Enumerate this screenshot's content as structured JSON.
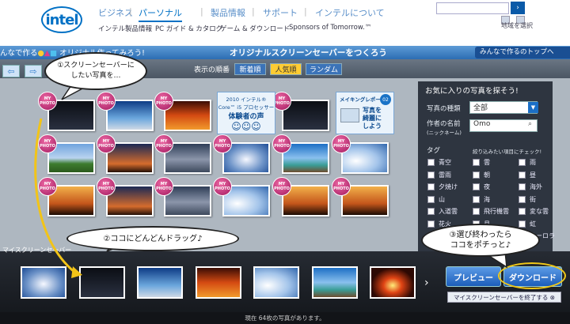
{
  "header": {
    "logo": "intel",
    "nav": [
      "ビジネス",
      "パーソナル",
      "製品情報",
      "サポート",
      "インテルについて"
    ],
    "active_index": 1,
    "subnav": [
      "インテル製品情報",
      "PC ガイド & カタログ",
      "ゲーム & ダウンロード",
      "Sponsors of Tomorrow.™"
    ],
    "search_button": "›",
    "region_label": "地域を選択"
  },
  "bluebar": {
    "left": "んなで作る",
    "left_cut": "オリジナル作ってみろう!",
    "title": "オリジナルスクリーンセーバーをつくろう",
    "right": "みんなで作るのトップへ"
  },
  "toolbar": {
    "sort_label": "表示の順番",
    "sort": [
      "新着順",
      "人気順",
      "ランダム"
    ],
    "active_sort": 1,
    "arrows": [
      "⇦",
      "⇨"
    ]
  },
  "grid": {
    "badge": "MY PHOTO",
    "rows": [
      [
        "s-night",
        "s-sky",
        "s-sunset",
        "promo1",
        "s-night",
        "promo2"
      ],
      [
        "s-green",
        "s-dusk",
        "s-lake",
        "s-cloud",
        "s-sea",
        "s-bright"
      ],
      [
        "s-palm",
        "s-dusk",
        "s-lake",
        "s-bright",
        "s-palm",
        "s-palm"
      ]
    ],
    "promo1": {
      "line1": "2010 インテル®",
      "line2": "Core™ i5 プロセッサー",
      "big": "体験者の声"
    },
    "promo2": {
      "title": "メイキングレポート",
      "num": "02",
      "text1": "写真を",
      "text2": "綺麗に",
      "text3": "しよう"
    }
  },
  "panel": {
    "title": "お気に入りの写真を探そう!",
    "type_label": "写真の種類",
    "type_value": "全部",
    "author_label": "作者の名前",
    "author_sub": "(ニックネーム)",
    "author_value": "Omo",
    "tag_label": "タグ",
    "tag_hint": "絞り込みたい項目にチェック!",
    "tags": [
      "青空",
      "雲",
      "雨",
      "雷雨",
      "朝",
      "昼",
      "夕焼け",
      "夜",
      "海外",
      "山",
      "海",
      "街",
      "入道雲",
      "飛行機雲",
      "変な雲",
      "花火",
      "月",
      "虹",
      "",
      "",
      "オーロラ"
    ]
  },
  "strip": {
    "label": "マイスクリーンセーバー",
    "thumbs": [
      "s-cloud",
      "s-night",
      "s-sky",
      "s-sunset",
      "s-bright",
      "s-sea",
      "s-red"
    ],
    "next": "›",
    "preview": "プレビュー",
    "download": "ダウンロード",
    "exit": "マイスクリーンセーバーを終了する ⊗"
  },
  "footer": "現在 64枚の写真があります。",
  "bubbles": {
    "one": "①スクリーンセーバーに\nしたい写真を…",
    "two": "②ココにどんどんドラッグ♪",
    "three": "③選び終わったら\nココをポチっと♪"
  },
  "colors": {
    "brand": "#0071c5",
    "accent": "#ffcc33",
    "badge": "#c2287a",
    "arrow": "#f2c418"
  }
}
